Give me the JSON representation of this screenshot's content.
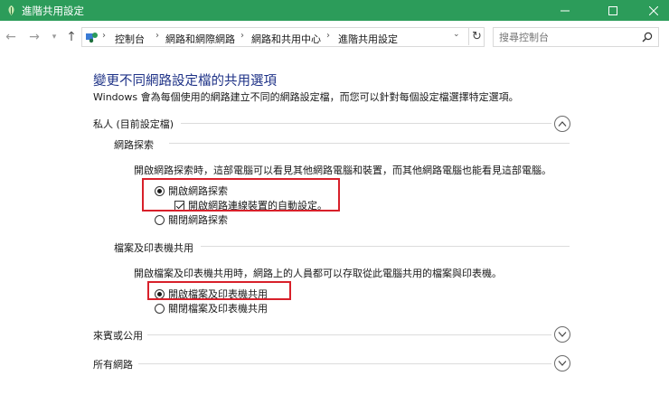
{
  "window": {
    "title": "進階共用設定",
    "controls": {
      "minimize": "minimize-icon",
      "maximize": "maximize-icon",
      "close": "close-icon"
    }
  },
  "address": {
    "breadcrumbs": [
      "控制台",
      "網路和網際網路",
      "網路和共用中心",
      "進階共用設定"
    ],
    "search_placeholder": "搜尋控制台"
  },
  "page": {
    "title": "變更不同網路設定檔的共用選項",
    "description": "Windows 會為每個使用的網路建立不同的網路設定檔，而您可以針對每個設定檔選擇特定選項。"
  },
  "sections": {
    "private": {
      "header": "私人 (目前設定檔)",
      "network_discovery": {
        "title": "網路探索",
        "description": "開啟網路探索時，這部電腦可以看見其他網路電腦和裝置，而其他網路電腦也能看見這部電腦。",
        "option_on": "開啟網路探索",
        "option_auto": "開啟網路連線裝置的自動設定。",
        "option_off": "關閉網路探索"
      },
      "file_printer_sharing": {
        "title": "檔案及印表機共用",
        "description": "開啟檔案及印表機共用時，網路上的人員都可以存取從此電腦共用的檔案與印表機。",
        "option_on": "開啟檔案及印表機共用",
        "option_off": "關閉檔案及印表機共用"
      }
    },
    "guest_public": {
      "header": "來賓或公用"
    },
    "all_networks": {
      "header": "所有網路"
    }
  },
  "colors": {
    "titlebar": "#2c9c5a",
    "title_text": "#1e3287",
    "highlight_box": "#d8202a"
  }
}
